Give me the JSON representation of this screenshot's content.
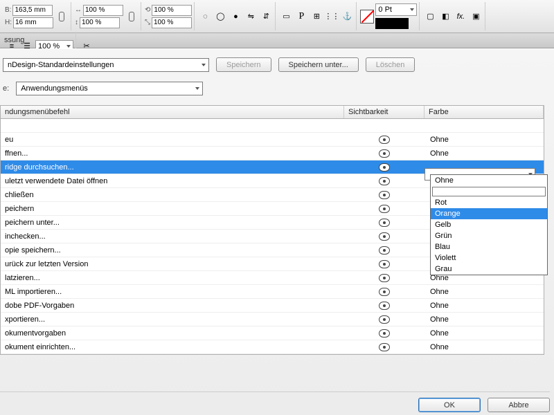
{
  "toolbar": {
    "dim_b_label": "B:",
    "dim_b_value": "163,5 mm",
    "dim_h_label": "H:",
    "dim_h_value": "16 mm",
    "scale_x": "100 %",
    "scale_y": "100 %",
    "scale_x2": "100 %",
    "scale_y2": "100 %",
    "pt_value": "0 Pt",
    "percent3": "100 %"
  },
  "tab_title": "ssung",
  "top_controls": {
    "preset_value": "nDesign-Standardeinstellungen",
    "save_label": "Speichern",
    "save_as_label": "Speichern unter...",
    "delete_label": "Löschen",
    "category_label": "e:",
    "category_value": "Anwendungsmenüs"
  },
  "columns": {
    "c1": "ndungsmenübefehl",
    "c2": "Sichtbarkeit",
    "c3": "Farbe"
  },
  "rows": [
    {
      "label": "",
      "eye": false,
      "color": ""
    },
    {
      "label": "eu",
      "eye": true,
      "color": "Ohne"
    },
    {
      "label": "ffnen...",
      "eye": true,
      "color": "Ohne"
    },
    {
      "label": "ridge durchsuchen...",
      "eye": true,
      "color": "Ohne",
      "selected": true,
      "dropdown": true
    },
    {
      "label": "uletzt verwendete Datei öffnen",
      "eye": true,
      "color": "Ohne"
    },
    {
      "label": "chließen",
      "eye": true,
      "color": ""
    },
    {
      "label": "peichern",
      "eye": true,
      "color": ""
    },
    {
      "label": "peichern unter...",
      "eye": true,
      "color": ""
    },
    {
      "label": "inchecken...",
      "eye": true,
      "color": ""
    },
    {
      "label": "opie speichern...",
      "eye": true,
      "color": ""
    },
    {
      "label": "urück zur letzten Version",
      "eye": true,
      "color": ""
    },
    {
      "label": "latzieren...",
      "eye": true,
      "color": "Ohne"
    },
    {
      "label": "ML importieren...",
      "eye": true,
      "color": "Ohne"
    },
    {
      "label": "dobe PDF-Vorgaben",
      "eye": true,
      "color": "Ohne"
    },
    {
      "label": "xportieren...",
      "eye": true,
      "color": "Ohne"
    },
    {
      "label": "okumentvorgaben",
      "eye": true,
      "color": "Ohne"
    },
    {
      "label": "okument einrichten...",
      "eye": true,
      "color": "Ohne"
    }
  ],
  "color_options": [
    "Ohne",
    "",
    "Rot",
    "Orange",
    "Gelb",
    "Grün",
    "Blau",
    "Violett",
    "Grau"
  ],
  "color_highlight_index": 3,
  "footer": {
    "ok": "OK",
    "cancel": "Abbre"
  }
}
